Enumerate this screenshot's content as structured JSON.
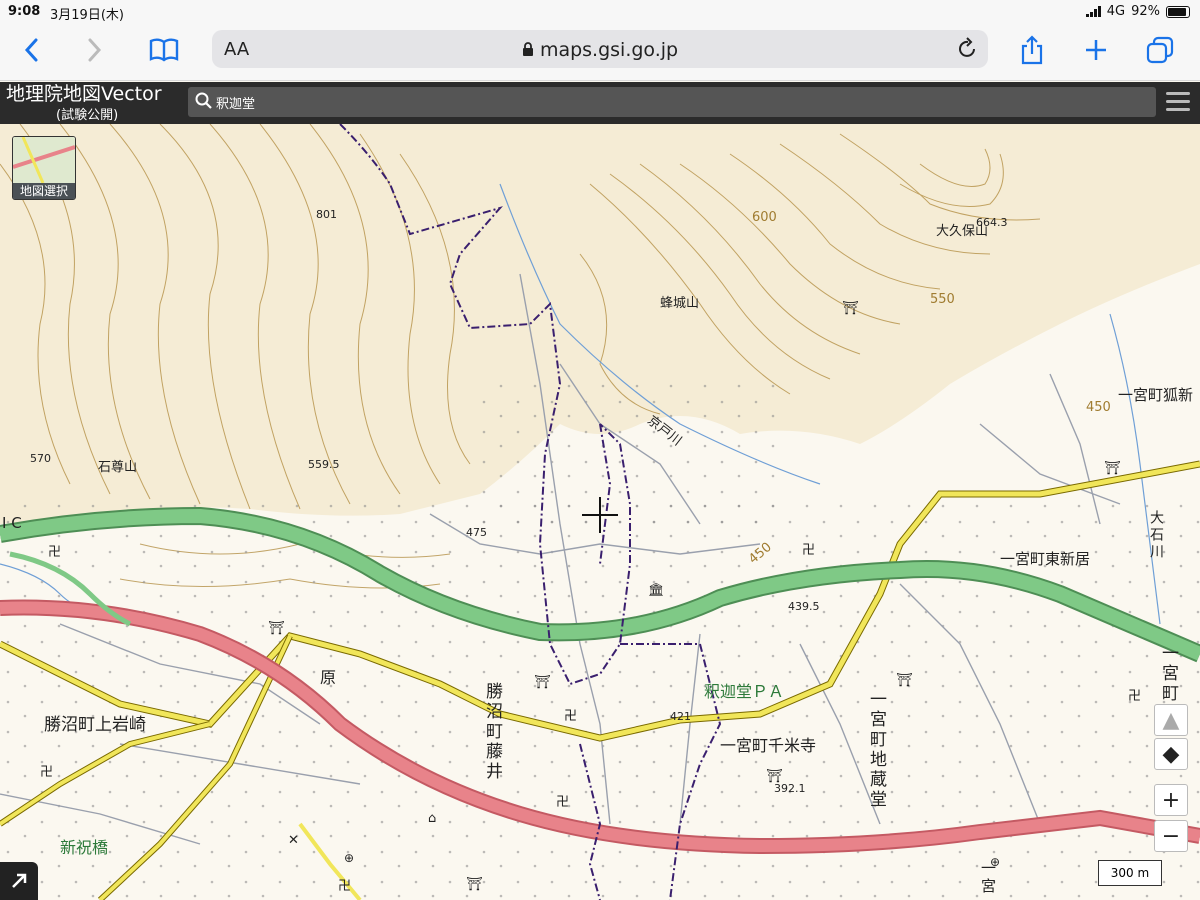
{
  "status": {
    "time": "9:08",
    "date": "3月19日(木)",
    "network": "4G",
    "battery": "92%"
  },
  "browser": {
    "aa": "AA",
    "url": "maps.gsi.go.jp"
  },
  "app": {
    "title": "地理院地図Vector",
    "subtitle": "(試験公開)",
    "search_value": "釈迦堂"
  },
  "map": {
    "layer_select": "地図選択",
    "scale": "300 m",
    "places": {
      "okubo": "大久保山",
      "hachijo": "蜂城山",
      "sekison": "石尊山",
      "kyodo": "京戸川",
      "kitsune": "一宮町狐新",
      "higashiara": "一宮町東新居",
      "oishi": "大石川",
      "ichinomiya": "一宮町",
      "kamiiwa": "勝沼町上岩崎",
      "hara": "原",
      "fujii": "勝沼町藤井",
      "pa": "釈迦堂ＰＡ",
      "senmai": "一宮町千米寺",
      "jizodo": "一宮町地蔵堂",
      "shiniwai": "新祝橋",
      "ic": "I C",
      "ichimiya2": "一宮"
    },
    "heights": {
      "h801": "801",
      "h664": "664.3",
      "h600": "600",
      "h550": "550",
      "h450": "450",
      "h450b": "450",
      "h570": "570",
      "h559": "559.5",
      "h475": "475",
      "h439": "439.5",
      "h421": "421",
      "h392": "392.1"
    },
    "legend_colors": {
      "contour": "#b08a3c",
      "expressway": "#6cbd75",
      "national": "#e07a80",
      "prefectural": "#ece154",
      "boundary": "#3a1f6e"
    }
  },
  "controls": {
    "zoom_in": "+",
    "zoom_out": "−"
  }
}
